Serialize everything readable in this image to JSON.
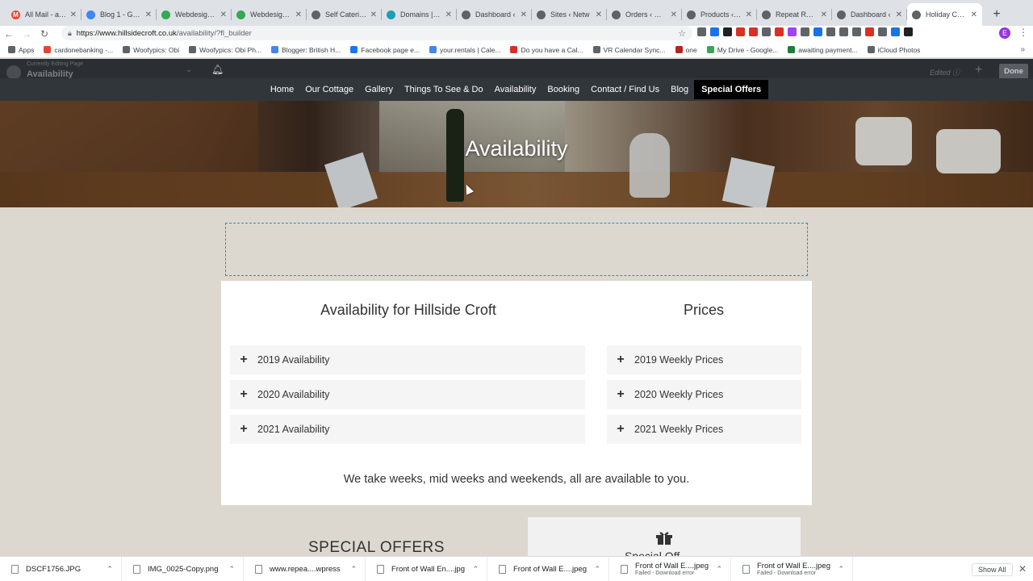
{
  "browser": {
    "tabs": [
      {
        "title": "All Mail - adm",
        "color": "#ea4335",
        "glyph": "M"
      },
      {
        "title": "Blog 1 - Goog",
        "color": "#4285f4",
        "glyph": ""
      },
      {
        "title": "Webdesign fo",
        "color": "#34a853",
        "glyph": ""
      },
      {
        "title": "Webdesign fo",
        "color": "#34a853",
        "glyph": ""
      },
      {
        "title": "Self Catering",
        "color": "#5f6368",
        "glyph": ""
      },
      {
        "title": "Domains | Us",
        "color": "#1a9fb3",
        "glyph": ""
      },
      {
        "title": "Dashboard ‹",
        "color": "#5f6368",
        "glyph": ""
      },
      {
        "title": "Sites ‹ Netw",
        "color": "#5f6368",
        "glyph": ""
      },
      {
        "title": "Orders ‹ Web",
        "color": "#5f6368",
        "glyph": ""
      },
      {
        "title": "Products ‹ W",
        "color": "#5f6368",
        "glyph": ""
      },
      {
        "title": "Repeat Retre",
        "color": "#5f6368",
        "glyph": ""
      },
      {
        "title": "Dashboard ‹",
        "color": "#5f6368",
        "glyph": ""
      },
      {
        "title": "Holiday Cotta",
        "color": "#5f6368",
        "glyph": ""
      }
    ],
    "url_host": "https://www.hillsidecroft.co.uk",
    "url_path": "/availability/?fl_builder",
    "bookmarks": [
      {
        "label": "Apps",
        "color": "#5f6368"
      },
      {
        "label": "cardonebanking -...",
        "color": "#ea4335"
      },
      {
        "label": "Woofypics: Obi",
        "color": "#5f6368"
      },
      {
        "label": "Woofypics: Obi Ph...",
        "color": "#5f6368"
      },
      {
        "label": "Blogger: British H...",
        "color": "#4285f4"
      },
      {
        "label": "Facebook page e...",
        "color": "#1877f2"
      },
      {
        "label": "your.rentals | Cale...",
        "color": "#4285f4"
      },
      {
        "label": "Do you have a Cal...",
        "color": "#d93025"
      },
      {
        "label": "VR Calendar Sync...",
        "color": "#5f6368"
      },
      {
        "label": "one",
        "color": "#b3261e"
      },
      {
        "label": "My Drive - Google...",
        "color": "#34a853"
      },
      {
        "label": "awaiting payment...",
        "color": "#188038"
      },
      {
        "label": "iCloud Photos",
        "color": "#5f6368"
      }
    ]
  },
  "builder": {
    "editing_label": "Currently Editing Page",
    "page_name": "Availability",
    "edited_label": "Edited",
    "done_label": "Done"
  },
  "site": {
    "nav": [
      "Home",
      "Our Cottage",
      "Gallery",
      "Things To See & Do",
      "Availability",
      "Booking",
      "Contact / Find Us",
      "Blog"
    ],
    "nav_special": "Special Offers",
    "hero_title": "Availability",
    "availability_title": "Availability for Hillside Croft",
    "prices_title": "Prices",
    "availability_items": [
      "2019 Availability",
      "2020 Availability",
      "2021 Availability"
    ],
    "price_items": [
      "2019 Weekly Prices",
      "2020 Weekly Prices",
      "2021 Weekly Prices"
    ],
    "note": "We take weeks, mid weeks and weekends, all are available to you.",
    "special_offers_heading": "SPECIAL OFFERS",
    "offer_box_title": "Special Off"
  },
  "downloads": {
    "items": [
      {
        "name": "DSCF1756.JPG",
        "sub": ""
      },
      {
        "name": "IMG_0025-Copy.png",
        "sub": ""
      },
      {
        "name": "www.repea....wpress",
        "sub": ""
      },
      {
        "name": "Front of Wall En....jpg",
        "sub": ""
      },
      {
        "name": "Front of Wall E....jpeg",
        "sub": ""
      },
      {
        "name": "Front of Wall E....jpeg",
        "sub": "Failed - Download error"
      },
      {
        "name": "Front of Wall E....jpeg",
        "sub": "Failed - Download error"
      }
    ],
    "show_all": "Show All"
  }
}
